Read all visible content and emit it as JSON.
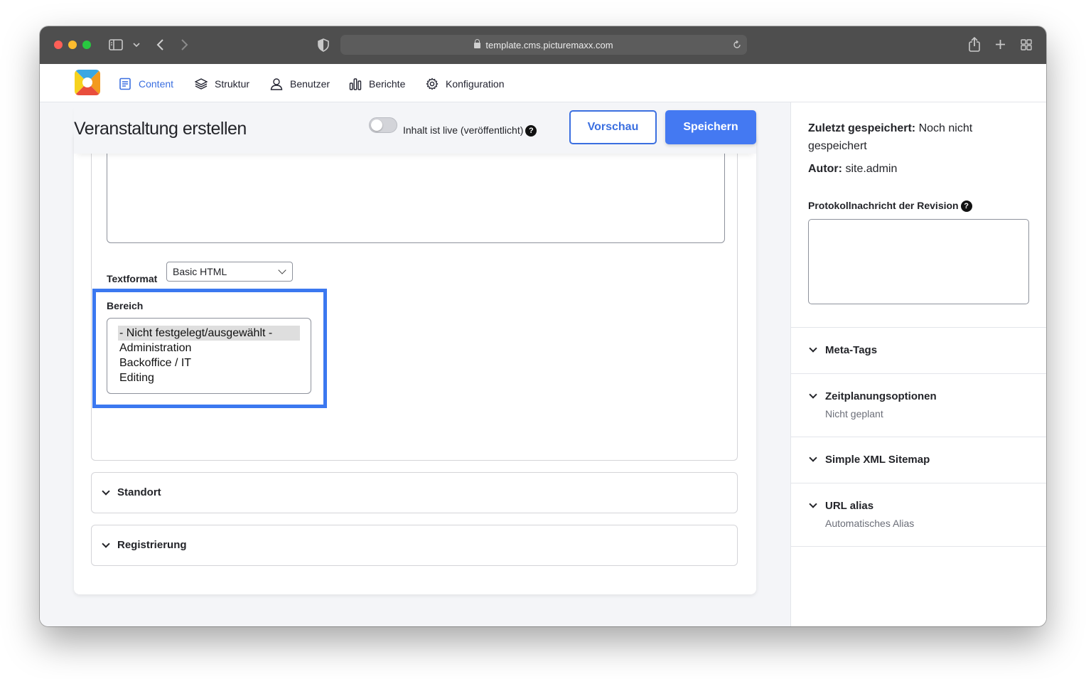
{
  "browser": {
    "url": "template.cms.picturemaxx.com"
  },
  "toolbar": {
    "items": [
      {
        "label": "Content",
        "icon": "document-icon",
        "active": true
      },
      {
        "label": "Struktur",
        "icon": "layers-icon"
      },
      {
        "label": "Benutzer",
        "icon": "user-icon"
      },
      {
        "label": "Berichte",
        "icon": "bar-chart-icon"
      },
      {
        "label": "Konfiguration",
        "icon": "gear-icon"
      }
    ]
  },
  "header": {
    "title": "Veranstaltung erstellen",
    "live_label": "Inhalt ist live (veröffentlicht)",
    "preview_label": "Vorschau",
    "save_label": "Speichern"
  },
  "form": {
    "textformat_label": "Textformat",
    "textformat_value": "Basic HTML",
    "bereich_label": "Bereich",
    "bereich_options": [
      "- Nicht festgelegt/ausgewählt -",
      "Administration",
      "Backoffice / IT",
      "Editing"
    ],
    "bereich_selected": "- Nicht festgelegt/ausgewählt -",
    "sections": [
      "Standort",
      "Registrierung"
    ]
  },
  "sidebar": {
    "last_saved_label": "Zuletzt gespeichert:",
    "last_saved_value": "Noch nicht",
    "last_saved_value_2": "gespeichert",
    "author_label": "Autor:",
    "author_value": "site.admin",
    "revision_label": "Protokollnachricht der Revision",
    "panels": [
      {
        "title": "Meta-Tags",
        "subtitle": ""
      },
      {
        "title": "Zeitplanungsoptionen",
        "subtitle": "Nicht geplant"
      },
      {
        "title": "Simple XML Sitemap",
        "subtitle": ""
      },
      {
        "title": "URL alias",
        "subtitle": "Automatisches Alias"
      }
    ]
  },
  "colors": {
    "accent": "#3b6fe0",
    "primary_button": "#4479f2",
    "highlight": "#3b78f0"
  }
}
